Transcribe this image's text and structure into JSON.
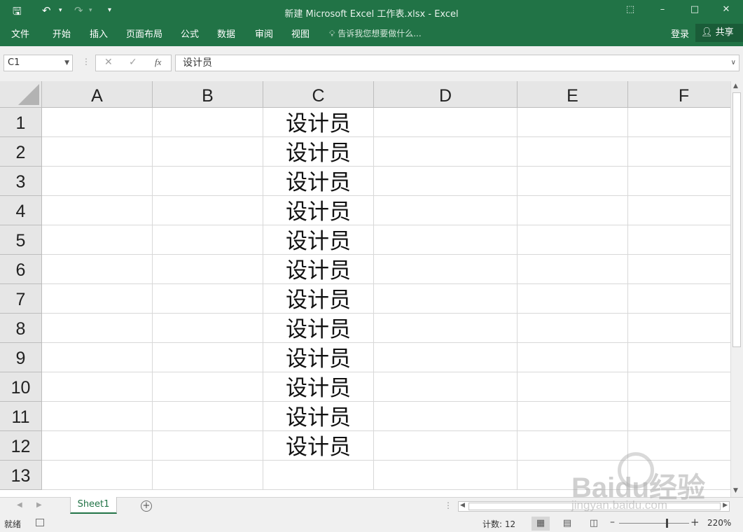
{
  "window": {
    "title": "新建 Microsoft Excel 工作表.xlsx - Excel"
  },
  "quick_access": {
    "icons": [
      "save-icon",
      "undo-icon",
      "redo-icon",
      "customize-icon"
    ]
  },
  "ribbon": {
    "tabs": [
      "文件",
      "开始",
      "插入",
      "页面布局",
      "公式",
      "数据",
      "审阅",
      "视图"
    ],
    "tell_me": "告诉我您想要做什么...",
    "sign_in": "登录",
    "share": "共享"
  },
  "formula_bar": {
    "name_box": "C1",
    "fx_label": "fx",
    "content": "设计员"
  },
  "grid": {
    "columns": [
      "A",
      "B",
      "C",
      "D",
      "E",
      "F"
    ],
    "rows": [
      "1",
      "2",
      "3",
      "4",
      "5",
      "6",
      "7",
      "8",
      "9",
      "10",
      "11",
      "12",
      "13"
    ],
    "column_c_values": [
      "设计员",
      "设计员",
      "设计员",
      "设计员",
      "设计员",
      "设计员",
      "设计员",
      "设计员",
      "设计员",
      "设计员",
      "设计员",
      "设计员",
      ""
    ]
  },
  "sheets": {
    "tabs": [
      "Sheet1"
    ]
  },
  "status_bar": {
    "ready": "就绪",
    "count": "计数: 12",
    "zoom": "220%"
  },
  "watermark": {
    "logo": "Baidu经验",
    "url": "jingyan.baidu.com"
  },
  "colors": {
    "excel_green": "#217346",
    "header_gray": "#e6e6e6"
  }
}
